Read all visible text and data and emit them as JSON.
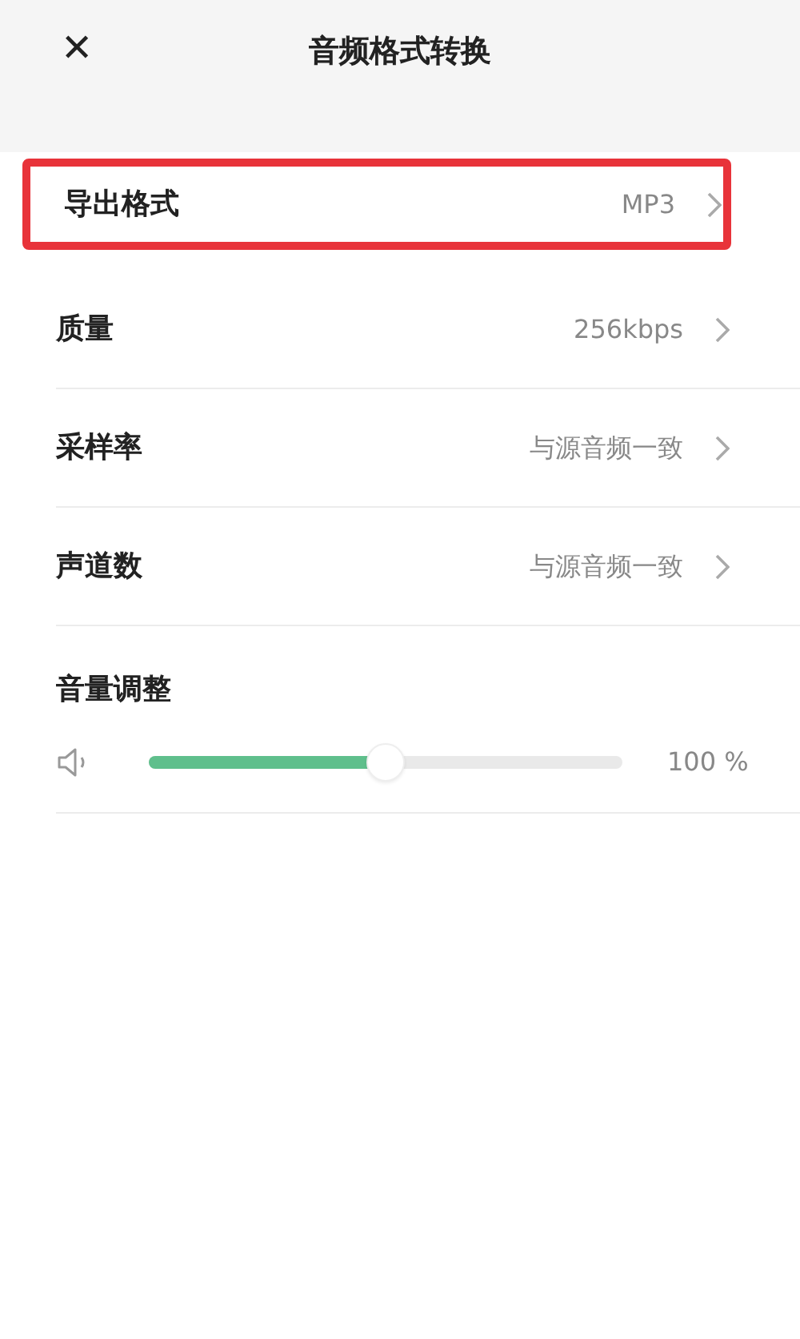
{
  "header": {
    "close_icon": "✕",
    "title": "音频格式转换"
  },
  "settings": [
    {
      "label": "导出格式",
      "value": "MP3",
      "highlighted": true
    },
    {
      "label": "质量",
      "value": "256kbps",
      "highlighted": false
    },
    {
      "label": "采样率",
      "value": "与源音频一致",
      "highlighted": false
    },
    {
      "label": "声道数",
      "value": "与源音频一致",
      "highlighted": false
    }
  ],
  "volume": {
    "title": "音量调整",
    "level": 0.5,
    "reading": "100 %"
  }
}
